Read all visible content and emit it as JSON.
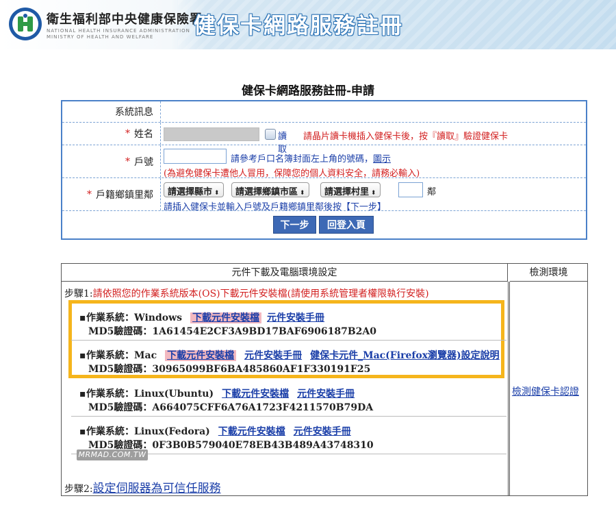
{
  "header": {
    "org_name_cn": "衛生福利部中央健康保險署",
    "org_name_en_line1": "NATIONAL HEALTH INSURANCE ADMINISTRATION",
    "org_name_en_line2": "MINISTRY OF HEALTH AND WELFARE",
    "banner_title": "健保卡網路服務註冊",
    "colors": {
      "banner_blue": "#c4ddef",
      "logo_green": "#2f9a46"
    }
  },
  "page_title": "健保卡網路服務註冊-申請",
  "form": {
    "system_message_label": "系統訊息",
    "system_message_value": "",
    "required_mark": "*",
    "name_label": "姓名",
    "read_button_label": "讀取",
    "read_hint": "請晶片讀卡機插入健保卡後，按『讀取』驗證健保卡",
    "household_label": "戶號",
    "household_value": "",
    "household_hint": "請參考戶口名簿封面左上角的號碼，",
    "household_hint_link": "圖示",
    "household_warning": "(為避免健保卡遭他人冒用，保障您的個人資料安全，請務必輸入)",
    "address_label": "戶籍鄉鎮里鄰",
    "county_select": "請選擇縣市",
    "township_select": "請選擇鄉鎮市區",
    "village_select": "請選擇村里",
    "neighbor_value": "",
    "neighbor_suffix": "鄰",
    "address_hint": "請插入健保卡並輸入戶號及戶籍鄉鎮里鄰後按【下一步】",
    "next_button": "下一步",
    "home_button": "回登入頁",
    "select_arrow": "⬍"
  },
  "downloads": {
    "header": "元件下載及電腦環境設定",
    "check_header": "檢測環境",
    "step1_prefix": "步驟1:",
    "step1_text": "請依照您的作業系統版本(OS)下載元件安裝檔(請使用系統管理者權限執行安裝)",
    "md5_prefix": "MD5驗證碼：",
    "bullet": "▪",
    "os_list": [
      {
        "os": "作業系統：Windows",
        "download": "下載元件安裝檔",
        "manual": "元件安裝手冊",
        "extra": "",
        "md5": "1A61454E2CF3A9BD17BAF6906187B2A0"
      },
      {
        "os": "作業系統：Mac",
        "download": "下載元件安裝檔",
        "manual": "元件安裝手冊",
        "extra": "健保卡元件_Mac(Firefox瀏覽器)設定說明",
        "md5": "30965099BF6BA485860AF1F330191F25"
      },
      {
        "os": "作業系統：Linux(Ubuntu)",
        "download": "下載元件安裝檔",
        "manual": "元件安裝手冊",
        "extra": "",
        "md5": "A664075CFF6A76A1723F4211570B79DA"
      },
      {
        "os": "作業系統：Linux(Fedora)",
        "download": "下載元件安裝檔",
        "manual": "元件安裝手冊",
        "extra": "",
        "md5": "0F3B0B579040E78EB43B489A43748310"
      }
    ],
    "step2_prefix": "步驟2:",
    "step2_link": "設定伺服器為可信任服務",
    "check_link": "檢測健保卡認證",
    "highlight_color": "#f2b8c0",
    "outline_color": "#f5b51c"
  },
  "watermark": "MRMAD.COM.TW"
}
